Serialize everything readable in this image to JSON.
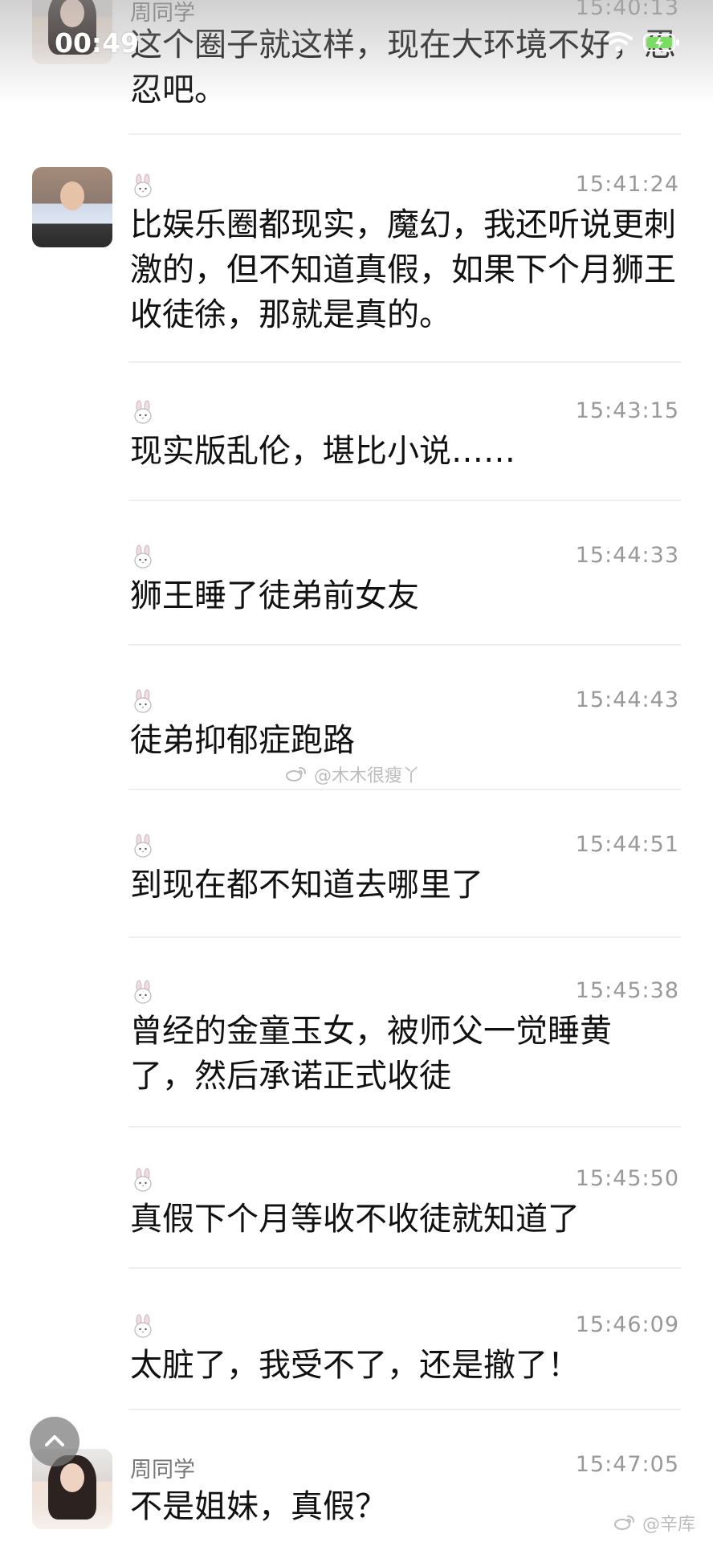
{
  "status": {
    "time": "00:49"
  },
  "messages": [
    {
      "sender": "周同学",
      "timestamp": "15:40:13",
      "text": "这个圈子就这样，现在大环境不好，忍忍吧。",
      "avatar": "female-avatar"
    },
    {
      "sender": "",
      "timestamp": "15:41:24",
      "text": "比娱乐圈都现实，魔幻，我还听说更刺激的，但不知道真假，如果下个月狮王收徒徐，那就是真的。",
      "avatar": "male-avatar"
    },
    {
      "sender": "",
      "timestamp": "15:43:15",
      "text": "现实版乱伦，堪比小说……"
    },
    {
      "sender": "",
      "timestamp": "15:44:33",
      "text": "狮王睡了徒弟前女友"
    },
    {
      "sender": "",
      "timestamp": "15:44:43",
      "text": "徒弟抑郁症跑路"
    },
    {
      "sender": "",
      "timestamp": "15:44:51",
      "text": "到现在都不知道去哪里了"
    },
    {
      "sender": "",
      "timestamp": "15:45:38",
      "text": "曾经的金童玉女，被师父一觉睡黄了，然后承诺正式收徒"
    },
    {
      "sender": "",
      "timestamp": "15:45:50",
      "text": "真假下个月等收不收徒就知道了"
    },
    {
      "sender": "",
      "timestamp": "15:46:09",
      "text": "太脏了，我受不了，还是撤了！"
    },
    {
      "sender": "周同学",
      "timestamp": "15:47:05",
      "text": "不是姐妹，真假？",
      "avatar": "female-avatar"
    }
  ],
  "watermarks": {
    "center": "@木木很瘦丫",
    "bottom": "@辛库"
  }
}
